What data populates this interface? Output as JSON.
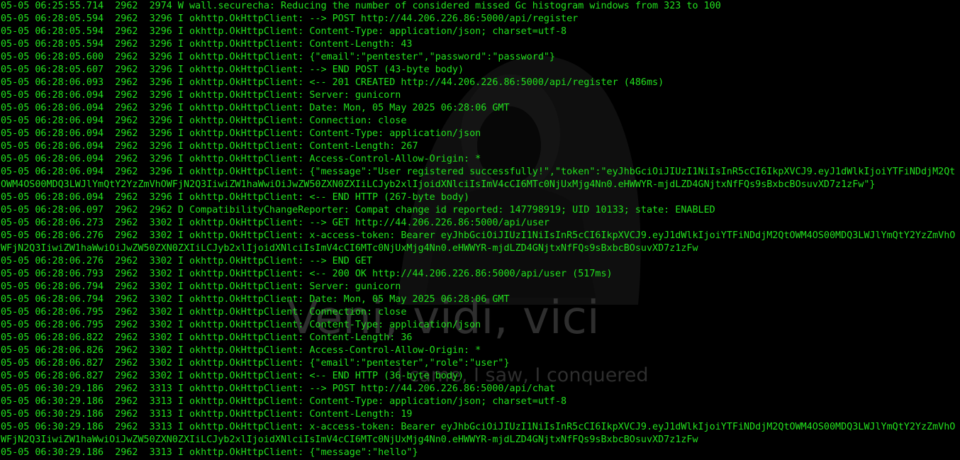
{
  "window": {
    "background": "#000000",
    "text_color": "#22e11e"
  },
  "wallpaper": {
    "motto_main": "Veni, vidi, vici",
    "motto_sub": "I came, I saw, I conquered"
  },
  "log_lines": [
    "05-05 06:25:55.714  2962  2974 W wall.securecha: Reducing the number of considered missed Gc histogram windows from 323 to 100",
    "05-05 06:28:05.594  2962  3296 I okhttp.OkHttpClient: --> POST http://44.206.226.86:5000/api/register",
    "05-05 06:28:05.594  2962  3296 I okhttp.OkHttpClient: Content-Type: application/json; charset=utf-8",
    "05-05 06:28:05.594  2962  3296 I okhttp.OkHttpClient: Content-Length: 43",
    "05-05 06:28:05.600  2962  3296 I okhttp.OkHttpClient: {\"email\":\"pentester\",\"password\":\"password\"}",
    "05-05 06:28:05.607  2962  3296 I okhttp.OkHttpClient: --> END POST (43-byte body)",
    "05-05 06:28:06.093  2962  3296 I okhttp.OkHttpClient: <-- 201 CREATED http://44.206.226.86:5000/api/register (486ms)",
    "05-05 06:28:06.094  2962  3296 I okhttp.OkHttpClient: Server: gunicorn",
    "05-05 06:28:06.094  2962  3296 I okhttp.OkHttpClient: Date: Mon, 05 May 2025 06:28:06 GMT",
    "05-05 06:28:06.094  2962  3296 I okhttp.OkHttpClient: Connection: close",
    "05-05 06:28:06.094  2962  3296 I okhttp.OkHttpClient: Content-Type: application/json",
    "05-05 06:28:06.094  2962  3296 I okhttp.OkHttpClient: Content-Length: 267",
    "05-05 06:28:06.094  2962  3296 I okhttp.OkHttpClient: Access-Control-Allow-Origin: *",
    "05-05 06:28:06.094  2962  3296 I okhttp.OkHttpClient: {\"message\":\"User registered successfully!\",\"token\":\"eyJhbGciOiJIUzI1NiIsInR5cCI6IkpXVCJ9.eyJ1dWlkIjoiYTFiNDdjM2QtOWM4OS00MDQ3LWJlYmQtY2YzZmVhOWFjN2Q3IiwiZW1haWwiOiJwZW50ZXN0ZXIiLCJyb2xlIjoidXNlciIsImV4cCI6MTc0NjUxMjg4Nn0.eHWWYR-mjdLZD4GNjtxNfFQs9sBxbcBOsuvXD7z1zFw\"}",
    "05-05 06:28:06.094  2962  3296 I okhttp.OkHttpClient: <-- END HTTP (267-byte body)",
    "05-05 06:28:06.097  2962  2962 D CompatibilityChangeReporter: Compat change id reported: 147798919; UID 10133; state: ENABLED",
    "05-05 06:28:06.273  2962  3302 I okhttp.OkHttpClient: --> GET http://44.206.226.86:5000/api/user",
    "05-05 06:28:06.276  2962  3302 I okhttp.OkHttpClient: x-access-token: Bearer eyJhbGciOiJIUzI1NiIsInR5cCI6IkpXVCJ9.eyJ1dWlkIjoiYTFiNDdjM2QtOWM4OS00MDQ3LWJlYmQtY2YzZmVhOWFjN2Q3IiwiZW1haWwiOiJwZW50ZXN0ZXIiLCJyb2xlIjoidXNlciIsImV4cCI6MTc0NjUxMjg4Nn0.eHWWYR-mjdLZD4GNjtxNfFQs9sBxbcBOsuvXD7z1zFw",
    "05-05 06:28:06.276  2962  3302 I okhttp.OkHttpClient: --> END GET",
    "05-05 06:28:06.793  2962  3302 I okhttp.OkHttpClient: <-- 200 OK http://44.206.226.86:5000/api/user (517ms)",
    "05-05 06:28:06.794  2962  3302 I okhttp.OkHttpClient: Server: gunicorn",
    "05-05 06:28:06.794  2962  3302 I okhttp.OkHttpClient: Date: Mon, 05 May 2025 06:28:06 GMT",
    "05-05 06:28:06.795  2962  3302 I okhttp.OkHttpClient: Connection: close",
    "05-05 06:28:06.795  2962  3302 I okhttp.OkHttpClient: Content-Type: application/json",
    "05-05 06:28:06.822  2962  3302 I okhttp.OkHttpClient: Content-Length: 36",
    "05-05 06:28:06.826  2962  3302 I okhttp.OkHttpClient: Access-Control-Allow-Origin: *",
    "05-05 06:28:06.827  2962  3302 I okhttp.OkHttpClient: {\"email\":\"pentester\",\"role\":\"user\"}",
    "05-05 06:28:06.827  2962  3302 I okhttp.OkHttpClient: <-- END HTTP (36-byte body)",
    "05-05 06:30:29.186  2962  3313 I okhttp.OkHttpClient: --> POST http://44.206.226.86:5000/api/chat",
    "05-05 06:30:29.186  2962  3313 I okhttp.OkHttpClient: Content-Type: application/json; charset=utf-8",
    "05-05 06:30:29.186  2962  3313 I okhttp.OkHttpClient: Content-Length: 19",
    "05-05 06:30:29.186  2962  3313 I okhttp.OkHttpClient: x-access-token: Bearer eyJhbGciOiJIUzI1NiIsInR5cCI6IkpXVCJ9.eyJ1dWlkIjoiYTFiNDdjM2QtOWM4OS00MDQ3LWJlYmQtY2YzZmVhOWFjN2Q3IiwiZW1haWwiOiJwZW50ZXN0ZXIiLCJyb2xlIjoidXNlciIsImV4cCI6MTc0NjUxMjg4Nn0.eHWWYR-mjdLZD4GNjtxNfFQs9sBxbcBOsuvXD7z1zFw",
    "05-05 06:30:29.186  2962  3313 I okhttp.OkHttpClient: {\"message\":\"hello\"}"
  ]
}
